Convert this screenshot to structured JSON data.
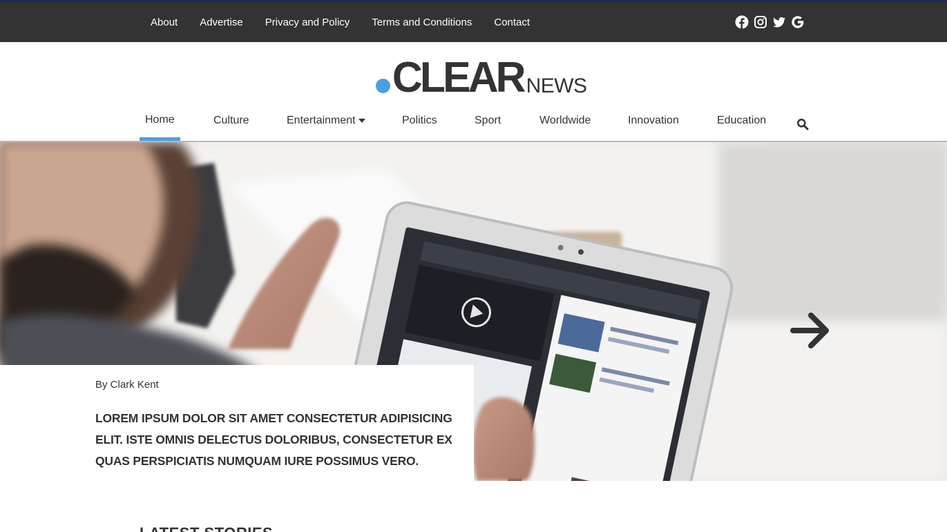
{
  "topbar": {
    "links": [
      "About",
      "Advertise",
      "Privacy and Policy",
      "Terms and Conditions",
      "Contact"
    ],
    "social_icons": [
      "facebook-icon",
      "instagram-icon",
      "twitter-icon",
      "google-icon"
    ]
  },
  "logo": {
    "main": "CLEAR",
    "sub": "NEWS",
    "dot_color": "#4b9fe1"
  },
  "nav": {
    "items": [
      {
        "label": "Home",
        "active": true
      },
      {
        "label": "Culture"
      },
      {
        "label": "Entertainment",
        "dropdown": true
      },
      {
        "label": "Politics"
      },
      {
        "label": "Sport"
      },
      {
        "label": "Worldwide"
      },
      {
        "label": "Innovation"
      },
      {
        "label": "Education"
      }
    ],
    "search_icon": "search-icon",
    "accent_color": "#4b9fe1"
  },
  "hero": {
    "byline": "By Clark Kent",
    "headline": "LOREM IPSUM DOLOR SIT AMET CONSECTETUR ADIPISICING ELIT. ISTE OMNIS DELECTUS DOLORIBUS, CONSECTETUR EX QUAS PERSPICIATIS NUMQUAM IURE POSSIMUS VERO.",
    "next_icon": "arrow-right-icon"
  },
  "section": {
    "title": "LATEST STORIES"
  }
}
